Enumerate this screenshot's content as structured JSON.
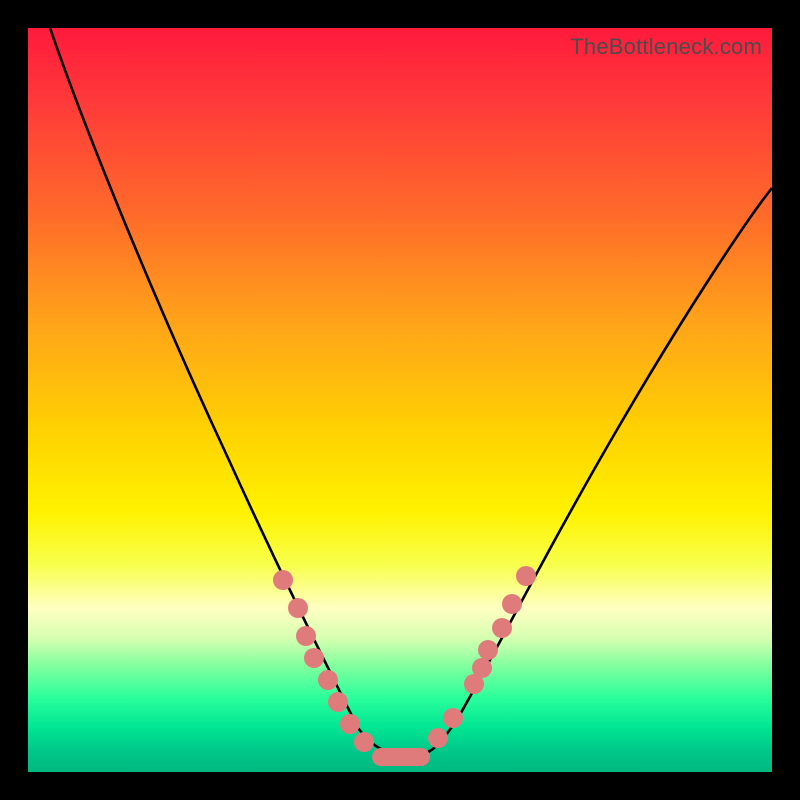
{
  "watermark": "TheBottleneck.com",
  "colors": {
    "frame": "#000000",
    "curve": "#000000",
    "marker_fill": "#e07b7b",
    "marker_stroke": "#c96363",
    "gradient_stops": [
      "#ff1a3c",
      "#ff3a3a",
      "#ff6a2a",
      "#ffa519",
      "#ffd400",
      "#fff200",
      "#f7ff4a",
      "#ffffc2",
      "#d6ffb0",
      "#7cff9e",
      "#2bff9c",
      "#00e693",
      "#00c98a",
      "#00b87f"
    ]
  },
  "chart_data": {
    "type": "line",
    "title": "",
    "xlabel": "",
    "ylabel": "",
    "xlim": [
      0,
      100
    ],
    "ylim": [
      0,
      100
    ],
    "grid": false,
    "legend": false,
    "series": [
      {
        "name": "bottleneck-curve",
        "x": [
          3,
          10,
          18,
          25,
          30,
          35,
          38,
          40,
          42,
          44,
          46,
          48,
          50,
          53,
          56,
          59,
          63,
          68,
          75,
          85,
          100
        ],
        "y": [
          100,
          80,
          61,
          45,
          34,
          24,
          17,
          12,
          8,
          5,
          3,
          2,
          2,
          3,
          6,
          11,
          18,
          28,
          40,
          53,
          68
        ]
      }
    ],
    "markers": [
      {
        "name": "left-cluster",
        "points": [
          {
            "x": 34,
            "y": 26
          },
          {
            "x": 36,
            "y": 22
          },
          {
            "x": 37,
            "y": 18
          },
          {
            "x": 38,
            "y": 15
          },
          {
            "x": 40,
            "y": 12
          },
          {
            "x": 41,
            "y": 9
          },
          {
            "x": 43,
            "y": 6
          },
          {
            "x": 45,
            "y": 4
          }
        ]
      },
      {
        "name": "flat-segment",
        "type": "capsule",
        "x0": 46,
        "x1": 52,
        "y": 2
      },
      {
        "name": "right-cluster",
        "points": [
          {
            "x": 54,
            "y": 4
          },
          {
            "x": 56,
            "y": 7
          },
          {
            "x": 59,
            "y": 12
          },
          {
            "x": 60,
            "y": 14
          },
          {
            "x": 61,
            "y": 17
          },
          {
            "x": 63,
            "y": 20
          },
          {
            "x": 64,
            "y": 23
          },
          {
            "x": 66,
            "y": 27
          }
        ]
      }
    ]
  }
}
